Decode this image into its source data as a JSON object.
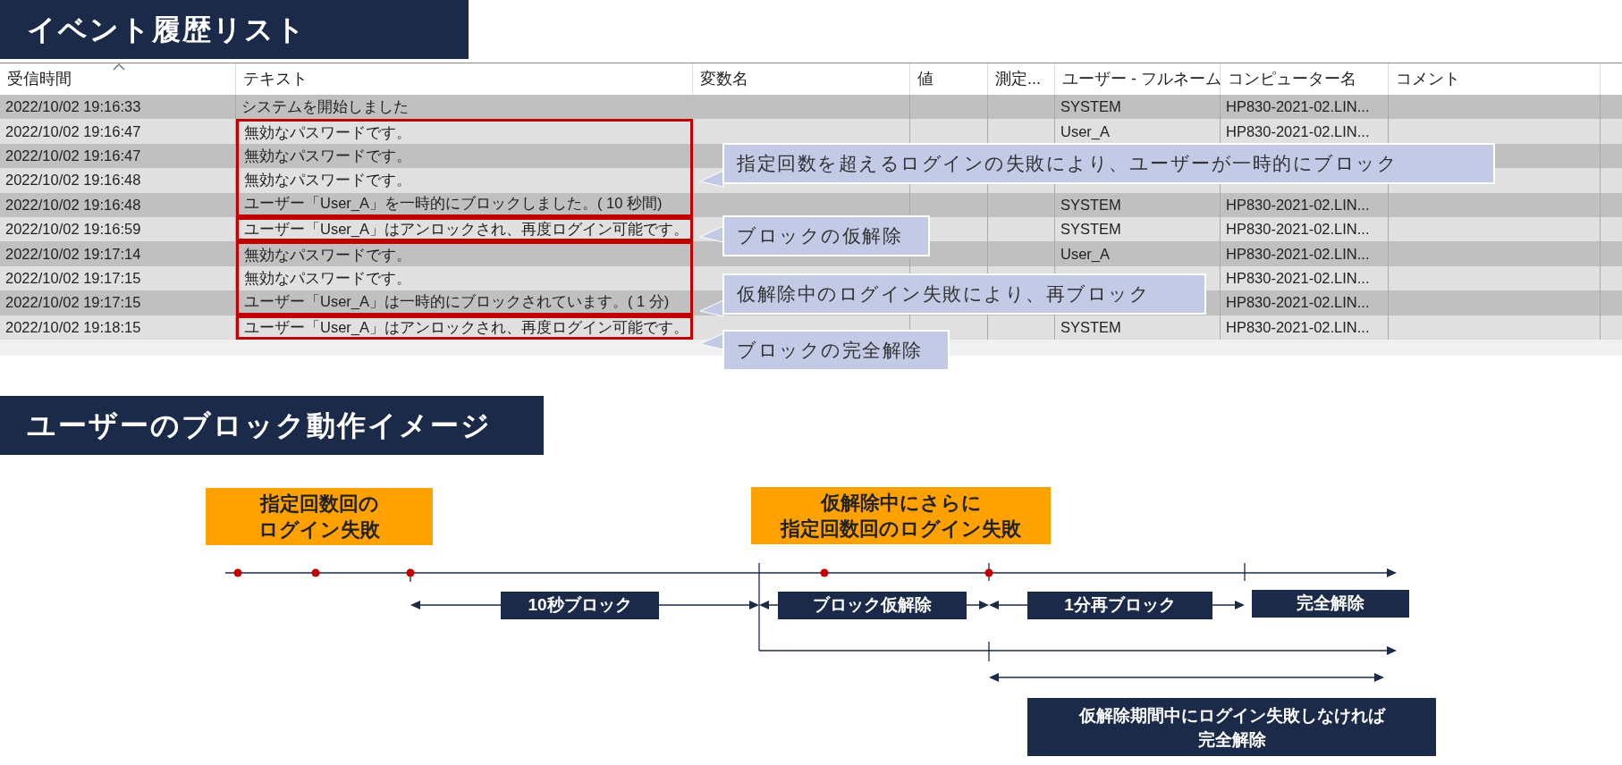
{
  "title": "イベント履歴リスト",
  "table": {
    "columns": [
      {
        "label": "受信時間",
        "sorted": true
      },
      {
        "label": "テキスト",
        "sorted": false
      },
      {
        "label": "変数名",
        "sorted": false
      },
      {
        "label": "値",
        "sorted": false
      },
      {
        "label": "測定...",
        "sorted": false
      },
      {
        "label": "ユーザー - フルネーム",
        "sorted": false
      },
      {
        "label": "コンピューター名",
        "sorted": false
      },
      {
        "label": "コメント",
        "sorted": false
      }
    ],
    "rows": [
      {
        "time": "2022/10/02 19:16:33",
        "text": "システムを開始しました",
        "user": "SYSTEM",
        "computer": "HP830-2021-02.LIN...",
        "boxed": false,
        "box_start": false
      },
      {
        "time": "2022/10/02 19:16:47",
        "text": "無効なパスワードです。",
        "user": "User_A",
        "computer": "HP830-2021-02.LIN...",
        "boxed": true,
        "box_start": true
      },
      {
        "time": "2022/10/02 19:16:47",
        "text": "無効なパスワードです。",
        "boxed": true,
        "box_start": false
      },
      {
        "time": "2022/10/02 19:16:48",
        "text": "無効なパスワードです。",
        "boxed": true,
        "box_start": false
      },
      {
        "time": "2022/10/02 19:16:48",
        "text": "ユーザー「User_A」を一時的にブロックしました。( 10 秒間)",
        "user": "SYSTEM",
        "computer": "HP830-2021-02.LIN...",
        "boxed": true,
        "box_start": false
      },
      {
        "time": "2022/10/02 19:16:59",
        "text": "ユーザー「User_A」はアンロックされ、再度ログイン可能です。",
        "user": "SYSTEM",
        "computer": "HP830-2021-02.LIN...",
        "boxed": true,
        "box_start": true
      },
      {
        "time": "2022/10/02 19:17:14",
        "text": "無効なパスワードです。",
        "user": "User_A",
        "computer": "HP830-2021-02.LIN...",
        "boxed": true,
        "box_start": true
      },
      {
        "time": "2022/10/02 19:17:15",
        "text": "無効なパスワードです。",
        "computer": "HP830-2021-02.LIN...",
        "boxed": true,
        "box_start": false
      },
      {
        "time": "2022/10/02 19:17:15",
        "text": "ユーザー「User_A」は一時的にブロックされています。( 1 分)",
        "computer": "HP830-2021-02.LIN...",
        "boxed": true,
        "box_start": false
      },
      {
        "time": "2022/10/02 19:18:15",
        "text": "ユーザー「User_A」はアンロックされ、再度ログイン可能です。",
        "user": "SYSTEM",
        "computer": "HP830-2021-02.LIN...",
        "boxed": true,
        "box_start": true
      }
    ]
  },
  "callouts": [
    "指定回数を超えるログインの失敗により、ユーザーが一時的にブロック",
    "ブロックの仮解除",
    "仮解除中のログイン失敗により、再ブロック",
    "ブロックの完全解除"
  ],
  "section_title": "ユーザーのブロック動作イメージ",
  "diagram": {
    "triggers": [
      [
        "指定回数回の",
        "ログイン失敗"
      ],
      [
        "仮解除中にさらに",
        "指定回数回のログイン失敗"
      ]
    ],
    "phases": [
      "10秒ブロック",
      "ブロック仮解除",
      "1分再ブロック",
      "完全解除"
    ],
    "note": [
      "仮解除期間中にログイン失敗しなければ",
      "完全解除"
    ]
  }
}
